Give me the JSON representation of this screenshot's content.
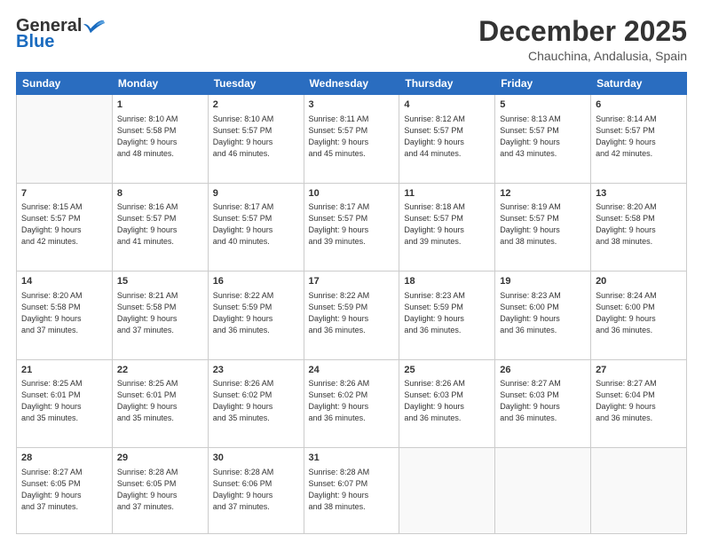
{
  "logo": {
    "general": "General",
    "blue": "Blue"
  },
  "header": {
    "month": "December 2025",
    "location": "Chauchina, Andalusia, Spain"
  },
  "days_of_week": [
    "Sunday",
    "Monday",
    "Tuesday",
    "Wednesday",
    "Thursday",
    "Friday",
    "Saturday"
  ],
  "weeks": [
    [
      {
        "day": "",
        "info": ""
      },
      {
        "day": "1",
        "info": "Sunrise: 8:10 AM\nSunset: 5:58 PM\nDaylight: 9 hours\nand 48 minutes."
      },
      {
        "day": "2",
        "info": "Sunrise: 8:10 AM\nSunset: 5:57 PM\nDaylight: 9 hours\nand 46 minutes."
      },
      {
        "day": "3",
        "info": "Sunrise: 8:11 AM\nSunset: 5:57 PM\nDaylight: 9 hours\nand 45 minutes."
      },
      {
        "day": "4",
        "info": "Sunrise: 8:12 AM\nSunset: 5:57 PM\nDaylight: 9 hours\nand 44 minutes."
      },
      {
        "day": "5",
        "info": "Sunrise: 8:13 AM\nSunset: 5:57 PM\nDaylight: 9 hours\nand 43 minutes."
      },
      {
        "day": "6",
        "info": "Sunrise: 8:14 AM\nSunset: 5:57 PM\nDaylight: 9 hours\nand 42 minutes."
      }
    ],
    [
      {
        "day": "7",
        "info": "Sunrise: 8:15 AM\nSunset: 5:57 PM\nDaylight: 9 hours\nand 42 minutes."
      },
      {
        "day": "8",
        "info": "Sunrise: 8:16 AM\nSunset: 5:57 PM\nDaylight: 9 hours\nand 41 minutes."
      },
      {
        "day": "9",
        "info": "Sunrise: 8:17 AM\nSunset: 5:57 PM\nDaylight: 9 hours\nand 40 minutes."
      },
      {
        "day": "10",
        "info": "Sunrise: 8:17 AM\nSunset: 5:57 PM\nDaylight: 9 hours\nand 39 minutes."
      },
      {
        "day": "11",
        "info": "Sunrise: 8:18 AM\nSunset: 5:57 PM\nDaylight: 9 hours\nand 39 minutes."
      },
      {
        "day": "12",
        "info": "Sunrise: 8:19 AM\nSunset: 5:57 PM\nDaylight: 9 hours\nand 38 minutes."
      },
      {
        "day": "13",
        "info": "Sunrise: 8:20 AM\nSunset: 5:58 PM\nDaylight: 9 hours\nand 38 minutes."
      }
    ],
    [
      {
        "day": "14",
        "info": "Sunrise: 8:20 AM\nSunset: 5:58 PM\nDaylight: 9 hours\nand 37 minutes."
      },
      {
        "day": "15",
        "info": "Sunrise: 8:21 AM\nSunset: 5:58 PM\nDaylight: 9 hours\nand 37 minutes."
      },
      {
        "day": "16",
        "info": "Sunrise: 8:22 AM\nSunset: 5:59 PM\nDaylight: 9 hours\nand 36 minutes."
      },
      {
        "day": "17",
        "info": "Sunrise: 8:22 AM\nSunset: 5:59 PM\nDaylight: 9 hours\nand 36 minutes."
      },
      {
        "day": "18",
        "info": "Sunrise: 8:23 AM\nSunset: 5:59 PM\nDaylight: 9 hours\nand 36 minutes."
      },
      {
        "day": "19",
        "info": "Sunrise: 8:23 AM\nSunset: 6:00 PM\nDaylight: 9 hours\nand 36 minutes."
      },
      {
        "day": "20",
        "info": "Sunrise: 8:24 AM\nSunset: 6:00 PM\nDaylight: 9 hours\nand 36 minutes."
      }
    ],
    [
      {
        "day": "21",
        "info": "Sunrise: 8:25 AM\nSunset: 6:01 PM\nDaylight: 9 hours\nand 35 minutes."
      },
      {
        "day": "22",
        "info": "Sunrise: 8:25 AM\nSunset: 6:01 PM\nDaylight: 9 hours\nand 35 minutes."
      },
      {
        "day": "23",
        "info": "Sunrise: 8:26 AM\nSunset: 6:02 PM\nDaylight: 9 hours\nand 35 minutes."
      },
      {
        "day": "24",
        "info": "Sunrise: 8:26 AM\nSunset: 6:02 PM\nDaylight: 9 hours\nand 36 minutes."
      },
      {
        "day": "25",
        "info": "Sunrise: 8:26 AM\nSunset: 6:03 PM\nDaylight: 9 hours\nand 36 minutes."
      },
      {
        "day": "26",
        "info": "Sunrise: 8:27 AM\nSunset: 6:03 PM\nDaylight: 9 hours\nand 36 minutes."
      },
      {
        "day": "27",
        "info": "Sunrise: 8:27 AM\nSunset: 6:04 PM\nDaylight: 9 hours\nand 36 minutes."
      }
    ],
    [
      {
        "day": "28",
        "info": "Sunrise: 8:27 AM\nSunset: 6:05 PM\nDaylight: 9 hours\nand 37 minutes."
      },
      {
        "day": "29",
        "info": "Sunrise: 8:28 AM\nSunset: 6:05 PM\nDaylight: 9 hours\nand 37 minutes."
      },
      {
        "day": "30",
        "info": "Sunrise: 8:28 AM\nSunset: 6:06 PM\nDaylight: 9 hours\nand 37 minutes."
      },
      {
        "day": "31",
        "info": "Sunrise: 8:28 AM\nSunset: 6:07 PM\nDaylight: 9 hours\nand 38 minutes."
      },
      {
        "day": "",
        "info": ""
      },
      {
        "day": "",
        "info": ""
      },
      {
        "day": "",
        "info": ""
      }
    ]
  ]
}
